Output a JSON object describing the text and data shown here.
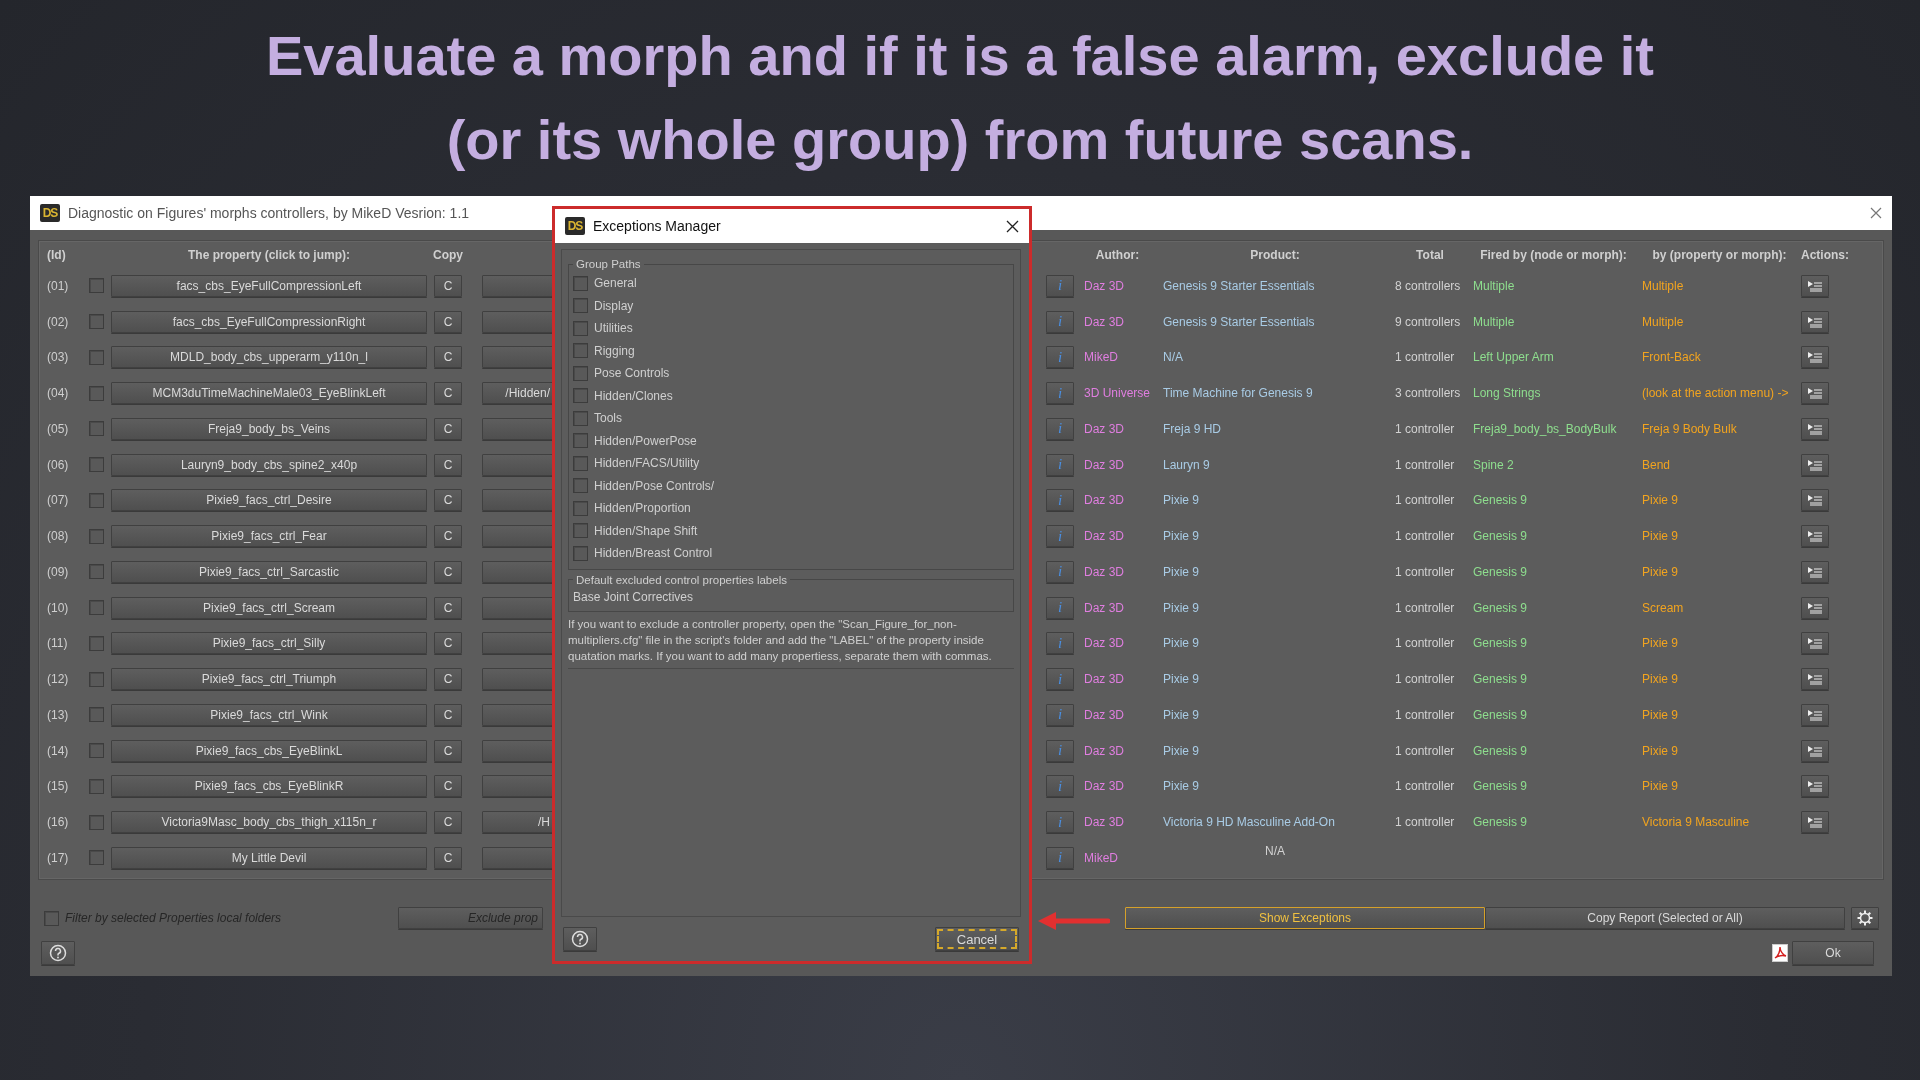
{
  "banner": {
    "lines": [
      "Evaluate a morph and if it is a false alarm, exclude it",
      "(or its whole group) from future scans."
    ]
  },
  "window": {
    "logo": "DS",
    "title": "Diagnostic on Figures' morphs controllers, by MikeD Vesrion: 1.1"
  },
  "table": {
    "columns": [
      "(Id)",
      "The property (click to jump):",
      "Copy",
      "Author:",
      "Product:",
      "Total",
      "Fired by (node or morph):",
      "by (property or morph):",
      "Actions:"
    ],
    "rows": [
      {
        "id": "(01)",
        "checked": false,
        "property": "facs_cbs_EyeFullCompressionLeft",
        "copy": "C",
        "info": "i",
        "author": "Daz 3D",
        "product": "Genesis 9 Starter Essentials",
        "total": "8 controllers",
        "fired_by": "Multiple",
        "by": "Multiple",
        "actions": true
      },
      {
        "id": "(02)",
        "checked": false,
        "property": "facs_cbs_EyeFullCompressionRight",
        "copy": "C",
        "info": "i",
        "author": "Daz 3D",
        "product": "Genesis 9 Starter Essentials",
        "total": "9 controllers",
        "fired_by": "Multiple",
        "by": "Multiple",
        "actions": true
      },
      {
        "id": "(03)",
        "checked": false,
        "property": "MDLD_body_cbs_upperarm_y110n_l",
        "copy": "C",
        "info": "i",
        "author": "MikeD",
        "product": "N/A",
        "total": "1 controller",
        "fired_by": "Left Upper Arm",
        "by": "Front-Back",
        "actions": true
      },
      {
        "id": "(04)",
        "checked": false,
        "property": "MCM3duTimeMachineMale03_EyeBlinkLeft",
        "copy": "C",
        "path": "/Hidden/",
        "info": "i",
        "author": "3D Universe",
        "product": "Time Machine for Genesis 9",
        "total": "3 controllers",
        "fired_by": "Long Strings",
        "by": "(look at the action menu) ->",
        "actions": true
      },
      {
        "id": "(05)",
        "checked": false,
        "property": "Freja9_body_bs_Veins",
        "copy": "C",
        "info": "i",
        "author": "Daz 3D",
        "product": "Freja 9 HD",
        "total": "1 controller",
        "fired_by": "Freja9_body_bs_BodyBulk",
        "by": "Freja 9 Body Bulk",
        "actions": true
      },
      {
        "id": "(06)",
        "checked": false,
        "property": "Lauryn9_body_cbs_spine2_x40p",
        "copy": "C",
        "info": "i",
        "author": "Daz 3D",
        "product": "Lauryn 9",
        "total": "1 controller",
        "fired_by": "Spine 2",
        "by": "Bend",
        "actions": true
      },
      {
        "id": "(07)",
        "checked": false,
        "property": "Pixie9_facs_ctrl_Desire",
        "copy": "C",
        "info": "i",
        "author": "Daz 3D",
        "product": "Pixie 9",
        "total": "1 controller",
        "fired_by": "Genesis 9",
        "by": "Pixie 9",
        "actions": true
      },
      {
        "id": "(08)",
        "checked": false,
        "property": "Pixie9_facs_ctrl_Fear",
        "copy": "C",
        "info": "i",
        "author": "Daz 3D",
        "product": "Pixie 9",
        "total": "1 controller",
        "fired_by": "Genesis 9",
        "by": "Pixie 9",
        "actions": true
      },
      {
        "id": "(09)",
        "checked": false,
        "property": "Pixie9_facs_ctrl_Sarcastic",
        "copy": "C",
        "info": "i",
        "author": "Daz 3D",
        "product": "Pixie 9",
        "total": "1 controller",
        "fired_by": "Genesis 9",
        "by": "Pixie 9",
        "actions": true
      },
      {
        "id": "(10)",
        "checked": false,
        "property": "Pixie9_facs_ctrl_Scream",
        "copy": "C",
        "info": "i",
        "author": "Daz 3D",
        "product": "Pixie 9",
        "total": "1 controller",
        "fired_by": "Genesis 9",
        "by": "Scream",
        "actions": true
      },
      {
        "id": "(11)",
        "checked": false,
        "property": "Pixie9_facs_ctrl_Silly",
        "copy": "C",
        "info": "i",
        "author": "Daz 3D",
        "product": "Pixie 9",
        "total": "1 controller",
        "fired_by": "Genesis 9",
        "by": "Pixie 9",
        "actions": true
      },
      {
        "id": "(12)",
        "checked": false,
        "property": "Pixie9_facs_ctrl_Triumph",
        "copy": "C",
        "info": "i",
        "author": "Daz 3D",
        "product": "Pixie 9",
        "total": "1 controller",
        "fired_by": "Genesis 9",
        "by": "Pixie 9",
        "actions": true
      },
      {
        "id": "(13)",
        "checked": false,
        "property": "Pixie9_facs_ctrl_Wink",
        "copy": "C",
        "info": "i",
        "author": "Daz 3D",
        "product": "Pixie 9",
        "total": "1 controller",
        "fired_by": "Genesis 9",
        "by": "Pixie 9",
        "actions": true
      },
      {
        "id": "(14)",
        "checked": false,
        "property": "Pixie9_facs_cbs_EyeBlinkL",
        "copy": "C",
        "info": "i",
        "author": "Daz 3D",
        "product": "Pixie 9",
        "total": "1 controller",
        "fired_by": "Genesis 9",
        "by": "Pixie 9",
        "actions": true
      },
      {
        "id": "(15)",
        "checked": false,
        "property": "Pixie9_facs_cbs_EyeBlinkR",
        "copy": "C",
        "info": "i",
        "author": "Daz 3D",
        "product": "Pixie 9",
        "total": "1 controller",
        "fired_by": "Genesis 9",
        "by": "Pixie 9",
        "actions": true
      },
      {
        "id": "(16)",
        "checked": false,
        "property": "Victoria9Masc_body_cbs_thigh_x115n_r",
        "copy": "C",
        "path": "/H",
        "info": "i",
        "author": "Daz 3D",
        "product": "Victoria 9 HD Masculine Add-On",
        "total": "1 controller",
        "fired_by": "Genesis 9",
        "by": "Victoria 9 Masculine",
        "actions": true
      },
      {
        "id": "(17)",
        "checked": false,
        "property": "My Little Devil",
        "copy": "C",
        "info": "i",
        "author": "MikeD",
        "product": "N/A",
        "actions": false
      }
    ]
  },
  "filter": {
    "label": "Filter by selected Properties local folders",
    "checked": false
  },
  "buttons": [
    {
      "label": "Exclude prop",
      "highlighted": false
    },
    {
      "label": "Show Exceptions",
      "highlighted": true
    },
    {
      "label": "Copy Report (Selected or All)",
      "highlighted": false
    }
  ],
  "ok_button": "Ok",
  "dialog": {
    "logo": "DS",
    "title": "Exceptions Manager",
    "group_paths": {
      "title": "Group Paths",
      "items": [
        {
          "label": "General",
          "checked": false
        },
        {
          "label": "Display",
          "checked": false
        },
        {
          "label": "Utilities",
          "checked": false
        },
        {
          "label": "Rigging",
          "checked": false
        },
        {
          "label": "Pose Controls",
          "checked": false
        },
        {
          "label": "Hidden/Clones",
          "checked": false
        },
        {
          "label": "Tools",
          "checked": false
        },
        {
          "label": "Hidden/PowerPose",
          "checked": false
        },
        {
          "label": "Hidden/FACS/Utility",
          "checked": false
        },
        {
          "label": "Hidden/Pose Controls/",
          "checked": false
        },
        {
          "label": "Hidden/Proportion",
          "checked": false
        },
        {
          "label": "Hidden/Shape Shift",
          "checked": false
        },
        {
          "label": "Hidden/Breast Control",
          "checked": false
        }
      ]
    },
    "defaults": {
      "title": "Default excluded control properties labels",
      "value": "Base Joint Correctives"
    },
    "note": "If you want to exclude a controller property, open the \"Scan_Figure_for_non-multipliers.cfg\" file in the script's folder and add the \"LABEL\"  of the property inside quatation marks. If you want to add many propertiess, separate them with commas.",
    "cancel": {
      "label": "Cancel",
      "focused": true
    }
  }
}
